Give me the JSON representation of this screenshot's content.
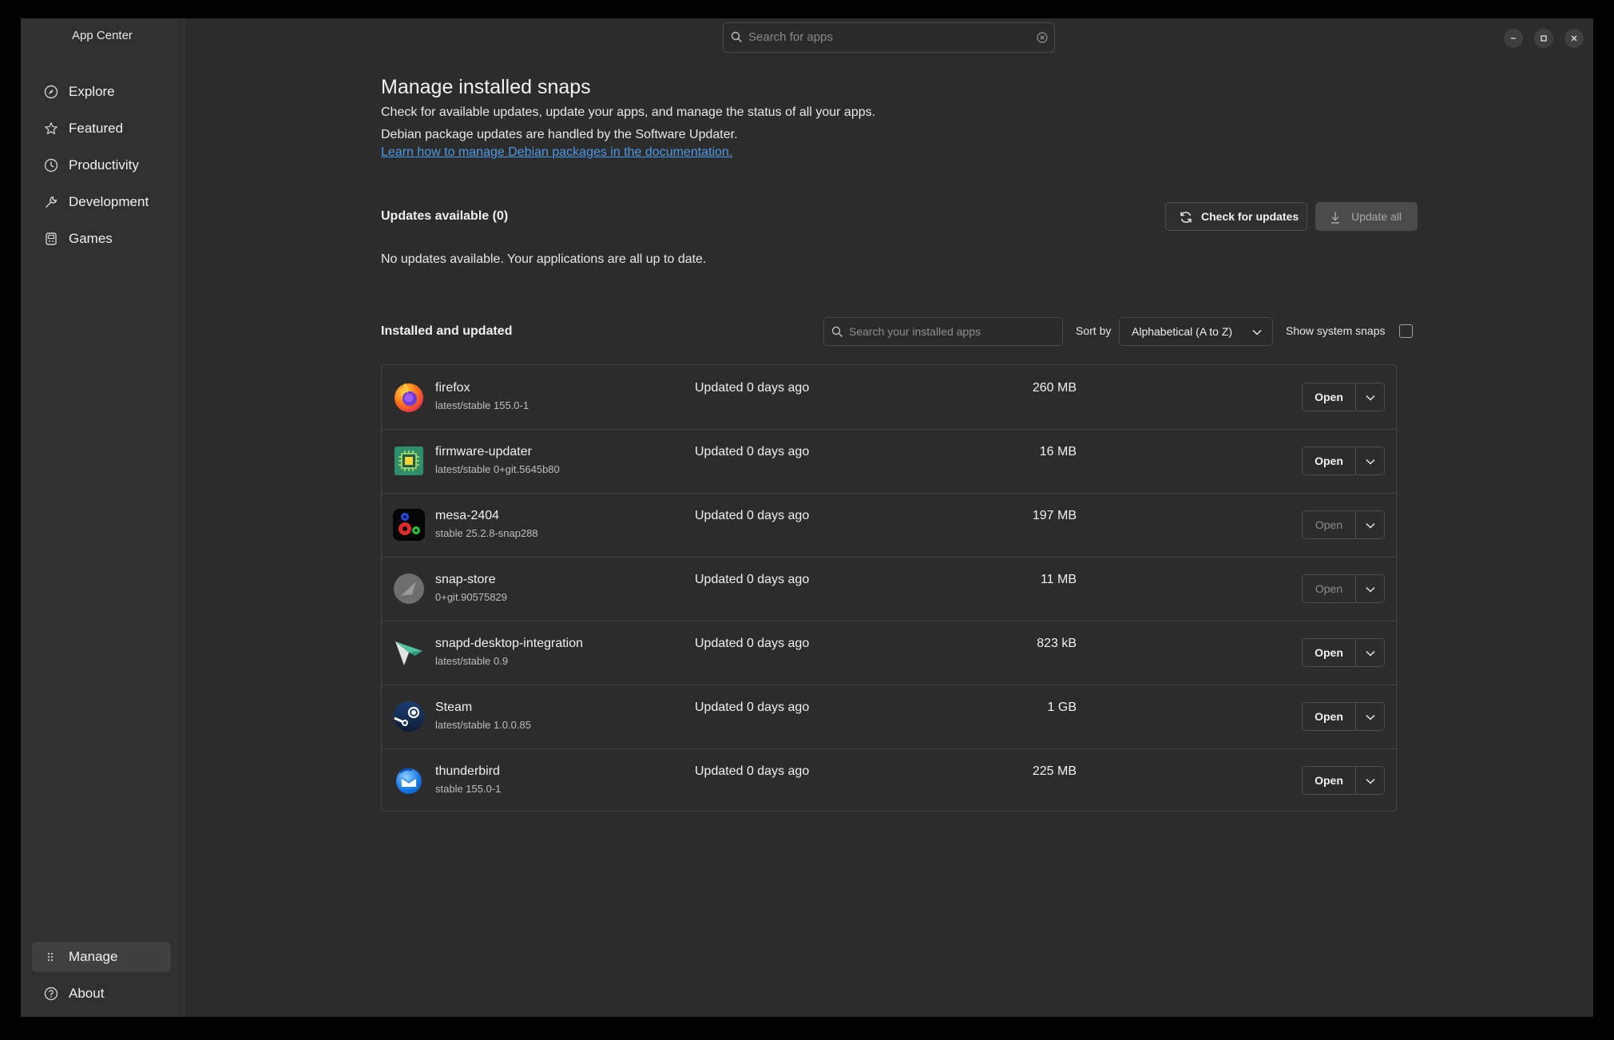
{
  "window": {
    "sidebar_title": "App Center",
    "top_search_placeholder": "Search for apps"
  },
  "sidebar": {
    "items": [
      {
        "label": "Explore",
        "icon": "compass-icon"
      },
      {
        "label": "Featured",
        "icon": "star-icon"
      },
      {
        "label": "Productivity",
        "icon": "clock-icon"
      },
      {
        "label": "Development",
        "icon": "wrench-icon"
      },
      {
        "label": "Games",
        "icon": "gamepad-icon"
      }
    ],
    "bottom": [
      {
        "label": "Manage",
        "icon": "grid-icon",
        "active": true
      },
      {
        "label": "About",
        "icon": "help-icon"
      }
    ]
  },
  "main": {
    "title": "Manage installed snaps",
    "desc1": "Check for available updates, update your apps, and manage the status of all your apps.",
    "desc2": "Debian package updates are handled by the Software Updater.",
    "link": "Learn how to manage Debian packages in the documentation.",
    "updates_heading": "Updates available (0)",
    "check_updates_label": "Check for updates",
    "update_all_label": "Update all",
    "no_updates_text": "No updates available. Your applications are all up to date.",
    "installed_heading": "Installed and updated",
    "installed_search_placeholder": "Search your installed apps",
    "sort_label": "Sort by",
    "sort_value": "Alphabetical (A to Z)",
    "system_snaps_label": "Show system snaps"
  },
  "apps": [
    {
      "name": "firefox",
      "version": "latest/stable 155.0-1",
      "updated": "Updated 0 days ago",
      "size": "260 MB",
      "open": "Open",
      "open_enabled": true
    },
    {
      "name": "firmware-updater",
      "version": "latest/stable 0+git.5645b80",
      "updated": "Updated 0 days ago",
      "size": "16 MB",
      "open": "Open",
      "open_enabled": true
    },
    {
      "name": "mesa-2404",
      "version": "stable 25.2.8-snap288",
      "updated": "Updated 0 days ago",
      "size": "197 MB",
      "open": "Open",
      "open_enabled": false
    },
    {
      "name": "snap-store",
      "version": " 0+git.90575829",
      "updated": "Updated 0 days ago",
      "size": "11 MB",
      "open": "Open",
      "open_enabled": false
    },
    {
      "name": "snapd-desktop-integration",
      "version": "latest/stable 0.9",
      "updated": "Updated 0 days ago",
      "size": "823 kB",
      "open": "Open",
      "open_enabled": true
    },
    {
      "name": "Steam",
      "version": "latest/stable 1.0.0.85",
      "updated": "Updated 0 days ago",
      "size": "1 GB",
      "open": "Open",
      "open_enabled": true
    },
    {
      "name": "thunderbird",
      "version": "stable 155.0-1",
      "updated": "Updated 0 days ago",
      "size": "225 MB",
      "open": "Open",
      "open_enabled": true
    }
  ],
  "colors": {
    "background": "#2c2c2c",
    "sidebar": "#303030",
    "link": "#4d9ae8"
  }
}
